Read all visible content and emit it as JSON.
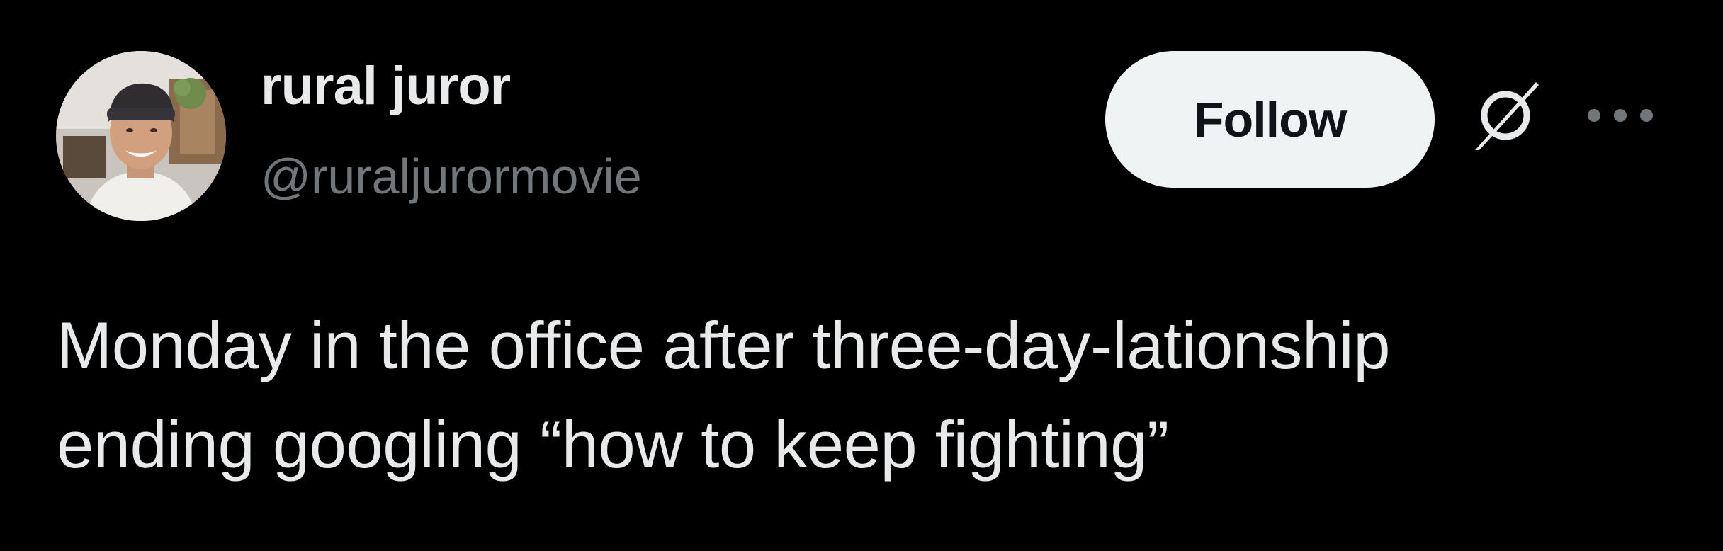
{
  "colors": {
    "background": "#000000",
    "primary_text": "#e7e9ea",
    "secondary_text": "#71767b",
    "follow_button_bg": "#eff3f4",
    "follow_button_text": "#0f1419"
  },
  "author": {
    "display_name": "rural juror",
    "handle": "@ruraljurormovie",
    "avatar_icon": "avatar-photo"
  },
  "actions": {
    "follow_label": "Follow",
    "grok_icon": "grok-icon",
    "more_icon": "more-horizontal-icon"
  },
  "tweet": {
    "lines": [
      "Monday in the office after three-day-lationship",
      "ending googling “how to keep fighting”"
    ]
  }
}
